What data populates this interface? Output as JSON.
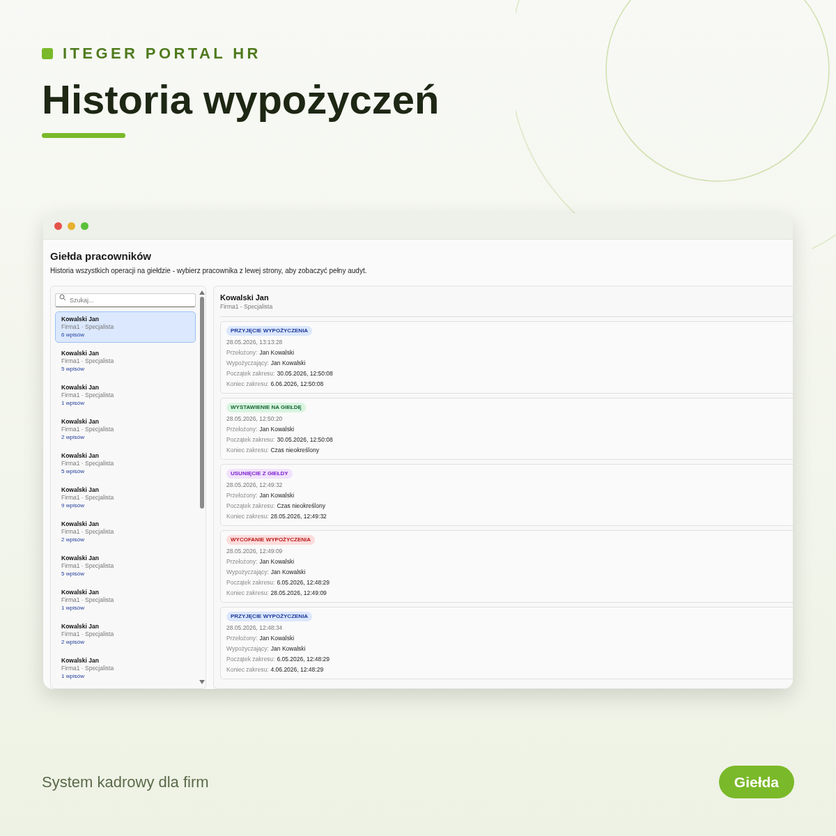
{
  "brand": "ITEGER PORTAL HR",
  "headline": "Historia wypożyczeń",
  "app": {
    "title": "Giełda pracowników",
    "description": "Historia wszystkich operacji na giełdzie - wybierz pracownika z lewej strony, aby zobaczyć pełny audyt.",
    "search": {
      "placeholder": "Szukaj..."
    },
    "employees": [
      {
        "name": "Kowalski Jan",
        "meta": "Firma1 · Specjalista",
        "count": "6 wpisów",
        "selected": true
      },
      {
        "name": "Kowalski Jan",
        "meta": "Firma1 · Specjalista",
        "count": "5 wpisów",
        "selected": false
      },
      {
        "name": "Kowalski Jan",
        "meta": "Firma1 · Specjalista",
        "count": "1 wpisów",
        "selected": false
      },
      {
        "name": "Kowalski Jan",
        "meta": "Firma1 · Specjalista",
        "count": "2 wpisów",
        "selected": false
      },
      {
        "name": "Kowalski Jan",
        "meta": "Firma1 · Specjalista",
        "count": "5 wpisów",
        "selected": false
      },
      {
        "name": "Kowalski Jan",
        "meta": "Firma1 · Specjalista",
        "count": "9 wpisów",
        "selected": false
      },
      {
        "name": "Kowalski Jan",
        "meta": "Firma1 · Specjalista",
        "count": "2 wpisów",
        "selected": false
      },
      {
        "name": "Kowalski Jan",
        "meta": "Firma1 · Specjalista",
        "count": "5 wpisów",
        "selected": false
      },
      {
        "name": "Kowalski Jan",
        "meta": "Firma1 · Specjalista",
        "count": "1 wpisów",
        "selected": false
      },
      {
        "name": "Kowalski Jan",
        "meta": "Firma1 · Specjalista",
        "count": "2 wpisów",
        "selected": false
      },
      {
        "name": "Kowalski Jan",
        "meta": "Firma1 · Specjalista",
        "count": "1 wpisów",
        "selected": false
      }
    ],
    "detail": {
      "name": "Kowalski Jan",
      "meta": "Firma1 - Specjalista",
      "entries": [
        {
          "kind": "accept",
          "badge": "PRZYJĘCIE WYPOŻYCZENIA",
          "time": "28.05.2026, 13:13:28",
          "fields": [
            {
              "label": "Przełożony:",
              "value": "Jan Kowalski"
            },
            {
              "label": "Wypożyczający:",
              "value": "Jan Kowalski"
            },
            {
              "label": "Początek zakresu:",
              "value": "30.05.2026, 12:50:08"
            },
            {
              "label": "Koniec zakresu:",
              "value": "6.06.2026, 12:50:08"
            }
          ]
        },
        {
          "kind": "listing",
          "badge": "WYSTAWIENIE NA GIEŁDĘ",
          "time": "28.05.2026, 12:50:20",
          "fields": [
            {
              "label": "Przełożony:",
              "value": "Jan Kowalski"
            },
            {
              "label": "Początek zakresu:",
              "value": "30.05.2026, 12:50:08"
            },
            {
              "label": "Koniec zakresu:",
              "value": "Czas nieokreślony"
            }
          ]
        },
        {
          "kind": "removal",
          "badge": "USUNIĘCIE Z GIEŁDY",
          "time": "28.05.2026, 12:49:32",
          "fields": [
            {
              "label": "Przełożony:",
              "value": "Jan Kowalski"
            },
            {
              "label": "Początek zakresu:",
              "value": "Czas nieokreślony"
            },
            {
              "label": "Koniec zakresu:",
              "value": "28.05.2026, 12:49:32"
            }
          ]
        },
        {
          "kind": "withdrawal",
          "badge": "WYCOFANIE WYPOŻYCZENIA",
          "time": "28.05.2026, 12:49:09",
          "fields": [
            {
              "label": "Przełożony:",
              "value": "Jan Kowalski"
            },
            {
              "label": "Wypożyczający:",
              "value": "Jan Kowalski"
            },
            {
              "label": "Początek zakresu:",
              "value": "6.05.2026, 12:48:29"
            },
            {
              "label": "Koniec zakresu:",
              "value": "28.05.2026, 12:49:09"
            }
          ]
        },
        {
          "kind": "accept",
          "badge": "PRZYJĘCIE WYPOŻYCZENIA",
          "time": "28.05.2026, 12:48:34",
          "fields": [
            {
              "label": "Przełożony:",
              "value": "Jan Kowalski"
            },
            {
              "label": "Wypożyczający:",
              "value": "Jan Kowalski"
            },
            {
              "label": "Początek zakresu:",
              "value": "6.05.2026, 12:48:29"
            },
            {
              "label": "Koniec zakresu:",
              "value": "4.06.2026, 12:48:29"
            }
          ]
        }
      ]
    }
  },
  "footer": {
    "tagline": "System kadrowy dla firm",
    "button": "Giełda"
  }
}
